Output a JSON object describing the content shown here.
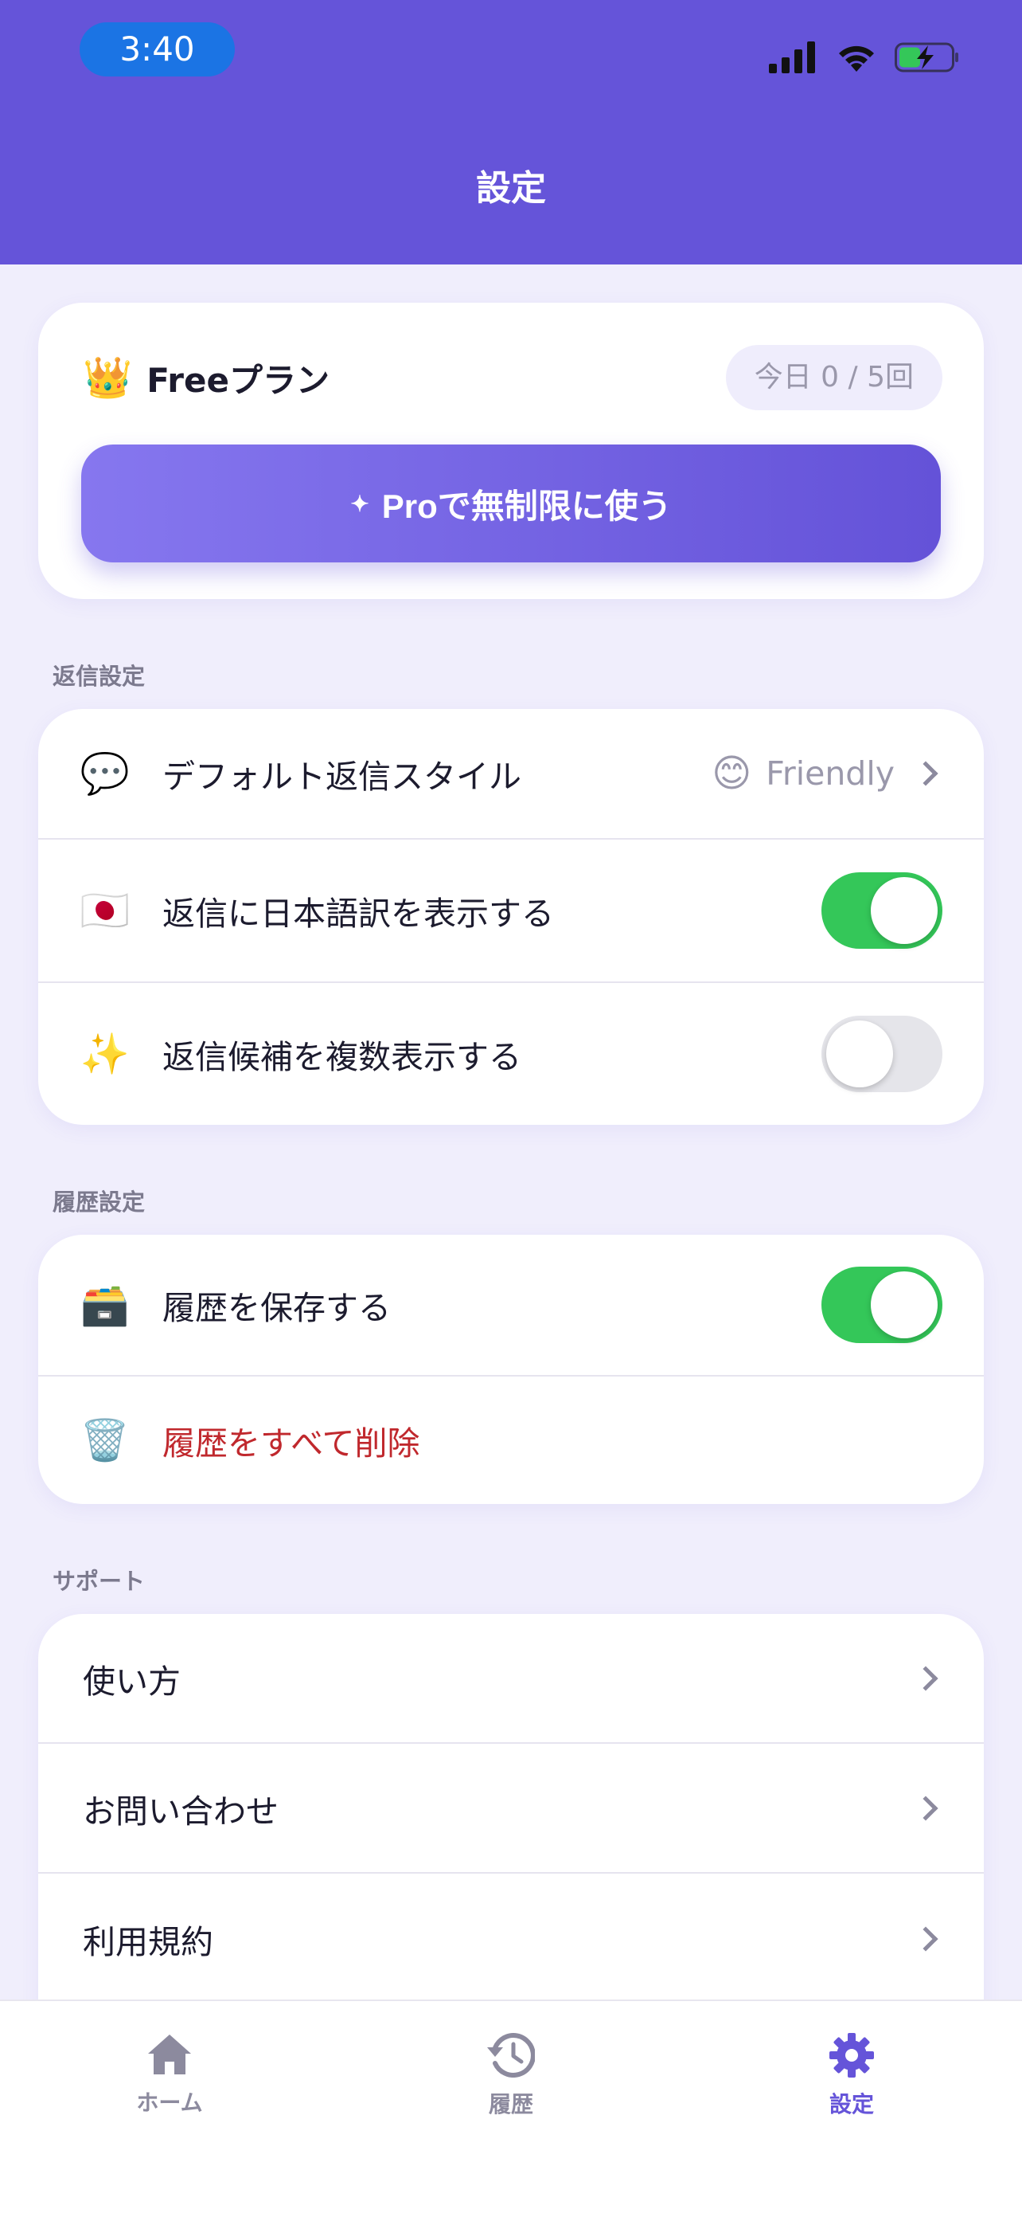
{
  "status_bar": {
    "time": "3:40"
  },
  "header": {
    "title": "設定"
  },
  "plan": {
    "name": "Freeプラン",
    "usage": "今日 0 / 5回",
    "pro_button_label": "Proで無制限に使う"
  },
  "sections": {
    "reply": {
      "label": "返信設定",
      "default_style_label": "デフォルト返信スタイル",
      "default_style_value": "Friendly",
      "show_translation_label": "返信に日本語訳を表示する",
      "show_translation_on": true,
      "multiple_candidates_label": "返信候補を複数表示する",
      "multiple_candidates_on": false
    },
    "history": {
      "label": "履歴設定",
      "save_history_label": "履歴を保存する",
      "save_history_on": true,
      "delete_all_label": "履歴をすべて削除"
    },
    "support": {
      "label": "サポート",
      "items": [
        "使い方",
        "お問い合わせ",
        "利用規約"
      ]
    }
  },
  "tabs": [
    {
      "label": "ホーム",
      "icon": "home-icon"
    },
    {
      "label": "履歴",
      "icon": "history-icon"
    },
    {
      "label": "設定",
      "icon": "gear-icon",
      "active": true
    }
  ],
  "colors": {
    "brand": "#6554d9",
    "toggle_on": "#34c759",
    "danger": "#c0282d"
  }
}
